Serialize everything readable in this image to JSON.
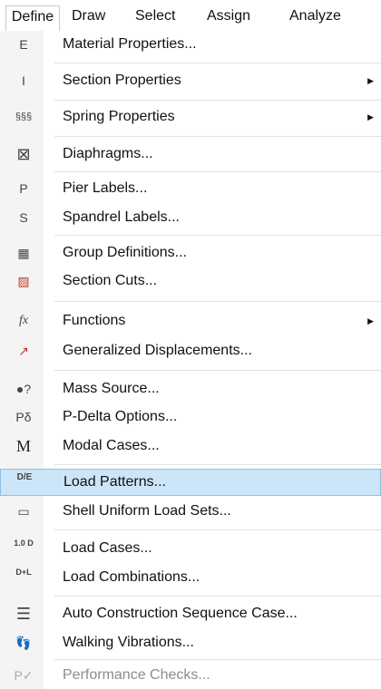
{
  "menubar": {
    "items": [
      "Define",
      "Draw",
      "Select",
      "Assign",
      "Analyze"
    ],
    "active": "Define"
  },
  "menu": {
    "items": [
      {
        "label": "Material Properties...",
        "icon": "material-properties-icon",
        "glyph": "E"
      },
      {
        "label": "Section Properties",
        "icon": "section-properties-icon",
        "glyph": "I",
        "submenu": true
      },
      {
        "label": "Spring Properties",
        "icon": "spring-properties-icon",
        "glyph": "§§§",
        "submenu": true
      },
      {
        "label": "Diaphragms...",
        "icon": "diaphragm-icon",
        "glyph": "⊠"
      },
      {
        "label": "Pier Labels...",
        "icon": "pier-labels-icon",
        "glyph": "P"
      },
      {
        "label": "Spandrel Labels...",
        "icon": "spandrel-labels-icon",
        "glyph": "S"
      },
      {
        "label": "Group Definitions...",
        "icon": "group-definitions-icon",
        "glyph": "▦"
      },
      {
        "label": "Section Cuts...",
        "icon": "section-cuts-icon",
        "glyph": "▨"
      },
      {
        "label": "Functions",
        "icon": "functions-icon",
        "glyph": "fx",
        "submenu": true
      },
      {
        "label": "Generalized Displacements...",
        "icon": "generalized-displacements-icon",
        "glyph": "↗"
      },
      {
        "label": "Mass Source...",
        "icon": "mass-source-icon",
        "glyph": "●?"
      },
      {
        "label": "P-Delta Options...",
        "icon": "p-delta-icon",
        "glyph": "Pδ"
      },
      {
        "label": "Modal Cases...",
        "icon": "modal-cases-icon",
        "glyph": "M"
      },
      {
        "label": "Load Patterns...",
        "icon": "load-patterns-icon",
        "glyph": "D/E",
        "highlighted": true
      },
      {
        "label": "Shell Uniform Load Sets...",
        "icon": "shell-load-sets-icon",
        "glyph": "▭"
      },
      {
        "label": "Load Cases...",
        "icon": "load-cases-icon",
        "glyph": "1.0 D"
      },
      {
        "label": "Load Combinations...",
        "icon": "load-combinations-icon",
        "glyph": "D+L"
      },
      {
        "label": "Auto Construction Sequence Case...",
        "icon": "construction-sequence-icon",
        "glyph": "☰"
      },
      {
        "label": "Walking Vibrations...",
        "icon": "walking-vibrations-icon",
        "glyph": "👣"
      },
      {
        "label": "Performance Checks...",
        "icon": "performance-checks-icon",
        "glyph": "P✓",
        "disabled": true
      }
    ]
  },
  "colors": {
    "highlight": "#cde5f8",
    "highlight_border": "#8fbfe6",
    "disabled_text": "#8c8c8c",
    "sidebar": "#f4f4f4"
  }
}
